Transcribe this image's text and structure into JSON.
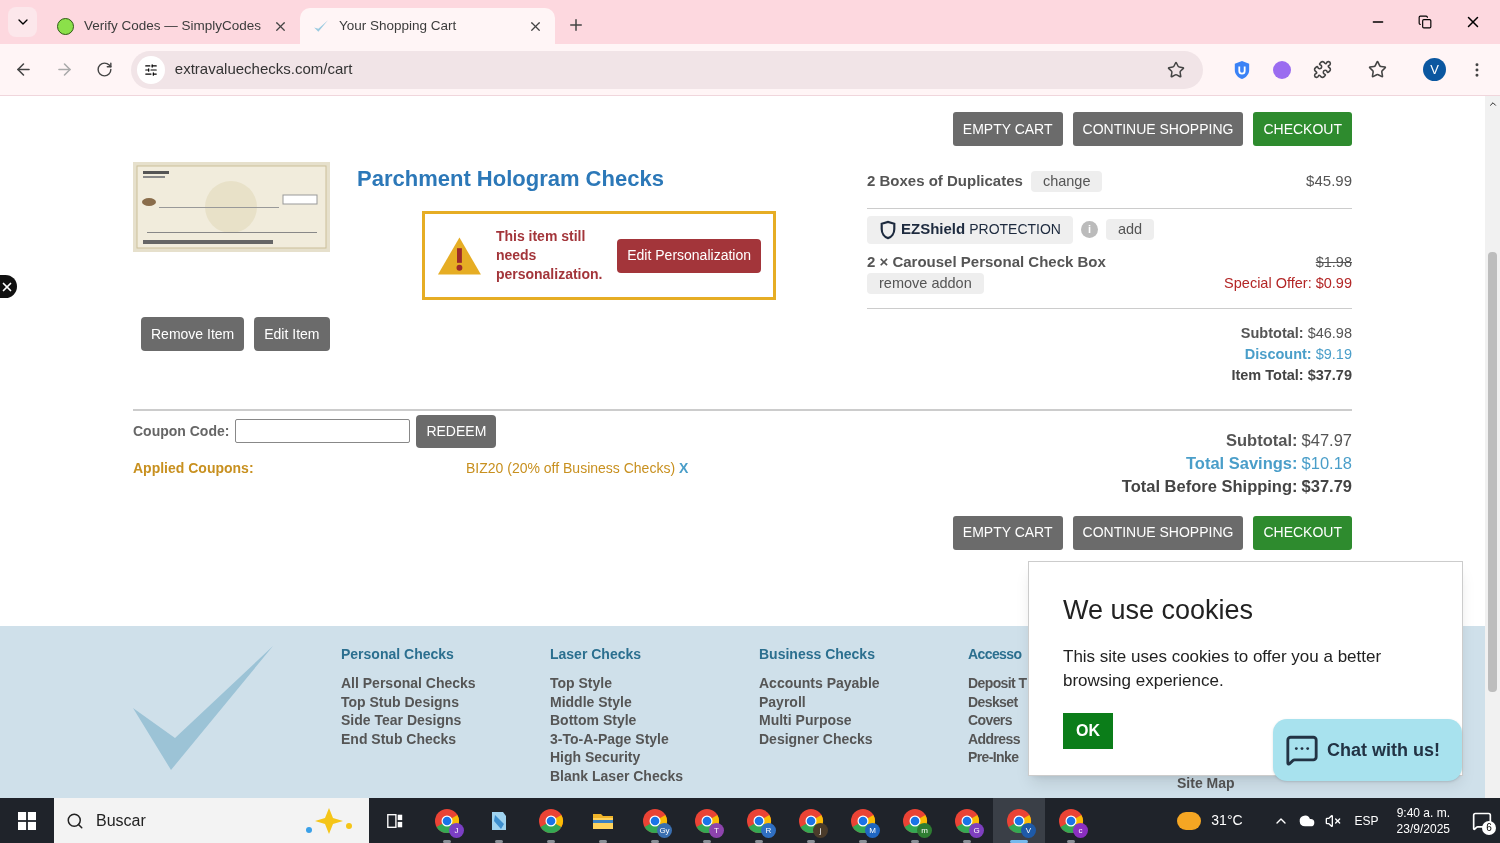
{
  "browser": {
    "tabs": [
      {
        "title": "Verify Codes — SimplyCodes",
        "selected": false
      },
      {
        "title": "Your Shopping Cart",
        "selected": true
      }
    ],
    "url": "extravaluechecks.com/cart",
    "profile_initial": "V"
  },
  "top_buttons": [
    {
      "label": "EMPTY CART",
      "kind": "secondary"
    },
    {
      "label": "CONTINUE SHOPPING",
      "kind": "secondary"
    },
    {
      "label": "CHECKOUT",
      "kind": "primary"
    }
  ],
  "item": {
    "title": "Parchment Hologram Checks",
    "alert_text": "This item still needs personalization.",
    "alert_button": "Edit Personalization",
    "actions": [
      "Remove Item",
      "Edit Item"
    ]
  },
  "summary": {
    "duplicates": {
      "label": "2 Boxes of Duplicates",
      "action": "change",
      "price": "$45.99"
    },
    "protection": {
      "brand": "EZShield",
      "suffix": "PROTECTION",
      "info": "i",
      "action": "add"
    },
    "addon": {
      "label": "2 × Carousel Personal Check Box",
      "action": "remove addon",
      "original_price": "$1.98",
      "offer": "Special Offer: $0.99"
    },
    "totals": [
      {
        "label": "Subtotal:",
        "value": "$46.98",
        "kind": "normal"
      },
      {
        "label": "Discount:",
        "value": "$9.19",
        "kind": "savings"
      },
      {
        "label": "Item Total:",
        "value": "$37.79",
        "kind": "total"
      }
    ]
  },
  "coupon": {
    "label": "Coupon Code:",
    "button": "REDEEM",
    "applied_label": "Applied Coupons:",
    "applied": "BIZ20 (20% off Business Checks)",
    "remove": "X"
  },
  "cart_totals": [
    {
      "label": "Subtotal:",
      "value": "$47.97",
      "kind": "normal"
    },
    {
      "label": "Total Savings:",
      "value": "$10.18",
      "kind": "savings"
    },
    {
      "label": "Total Before Shipping:",
      "value": "$37.79",
      "kind": "total"
    }
  ],
  "bottom_buttons": [
    {
      "label": "EMPTY CART",
      "kind": "secondary"
    },
    {
      "label": "CONTINUE SHOPPING",
      "kind": "secondary"
    },
    {
      "label": "CHECKOUT",
      "kind": "primary"
    }
  ],
  "footer": {
    "columns": [
      {
        "heading": "Personal Checks",
        "links": [
          "All Personal Checks",
          "Top Stub Designs",
          "Side Tear Designs",
          "End Stub Checks"
        ]
      },
      {
        "heading": "Laser Checks",
        "links": [
          "Top Style",
          "Middle Style",
          "Bottom Style",
          "3-To-A-Page Style",
          "High Security",
          "Blank Laser Checks"
        ]
      },
      {
        "heading": "Business Checks",
        "links": [
          "Accounts Payable",
          "Payroll",
          "Multi Purpose",
          "Designer Checks"
        ]
      },
      {
        "heading": "Accesso",
        "links": [
          "Deposit T",
          "Deskset",
          "Covers",
          "Address",
          "Pre-Inke"
        ]
      }
    ],
    "extra_links": [
      "Site Map"
    ]
  },
  "cookie": {
    "title": "We use cookies",
    "text": "This site uses cookies to offer you a better browsing experience.",
    "button": "OK"
  },
  "chat_button": "Chat with us!",
  "taskbar": {
    "search_placeholder": "Buscar",
    "apps": [
      {
        "kind": "chrome",
        "badge": "J",
        "color": "#7b3fc4",
        "selected": false
      },
      {
        "kind": "notes",
        "selected": false
      },
      {
        "kind": "chrome",
        "selected": false
      },
      {
        "kind": "explorer",
        "selected": false
      },
      {
        "kind": "chrome",
        "badge": "Gy",
        "color": "#3a6fb0",
        "selected": false
      },
      {
        "kind": "chrome",
        "badge": "T",
        "color": "#8e44ad",
        "selected": false
      },
      {
        "kind": "chrome",
        "badge": "R",
        "color": "#2f6fc2",
        "selected": false
      },
      {
        "kind": "chrome",
        "badge": "j",
        "color": "#4a3b2a",
        "selected": false
      },
      {
        "kind": "chrome",
        "badge": "M",
        "color": "#1f66c1",
        "selected": false
      },
      {
        "kind": "chrome",
        "badge": "m",
        "color": "#2e7d32",
        "selected": false
      },
      {
        "kind": "chrome",
        "badge": "G",
        "color": "#7e3fbf",
        "selected": false
      },
      {
        "kind": "chrome",
        "badge": "V",
        "color": "#1e5aa8",
        "selected": true
      },
      {
        "kind": "chrome",
        "badge": "c",
        "color": "#8a2fc0",
        "selected": false
      }
    ],
    "temperature": "31°C",
    "language": "ESP",
    "time": "9:40 a. m.",
    "date": "23/9/2025",
    "notifications": "6"
  }
}
